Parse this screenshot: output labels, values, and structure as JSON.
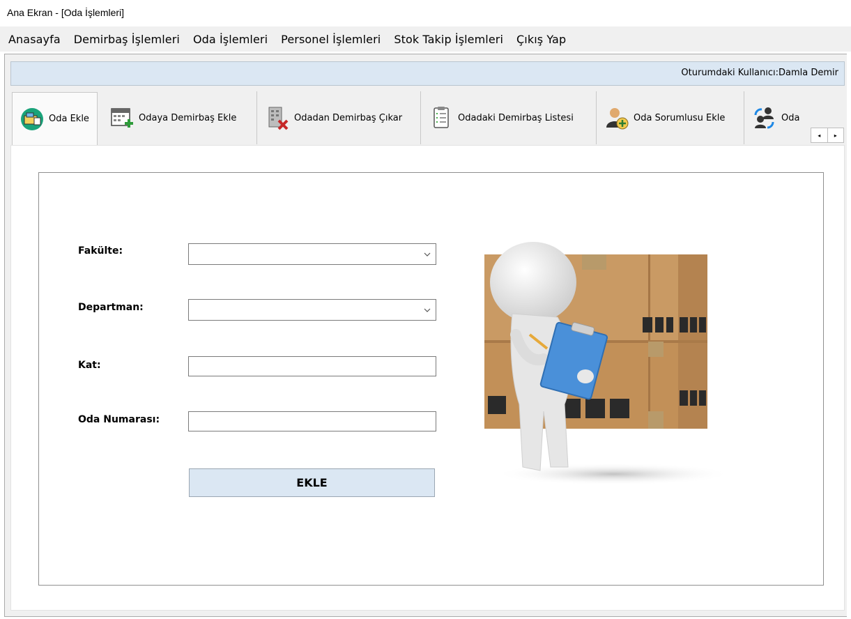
{
  "window": {
    "title": "Ana Ekran - [Oda İşlemleri]"
  },
  "menu": {
    "items": [
      "Anasayfa",
      "Demirbaş İşlemleri",
      "Oda İşlemleri",
      "Personel İşlemleri",
      "Stok Takip İşlemleri",
      "Çıkış Yap"
    ]
  },
  "session": {
    "user_text": "Oturumdaki Kullanıcı:Damla Demir"
  },
  "tabs": [
    {
      "label": "Oda Ekle",
      "icon": "room-add-icon"
    },
    {
      "label": "Odaya Demirbaş Ekle",
      "icon": "calendar-add-icon"
    },
    {
      "label": "Odadan Demirbaş Çıkar",
      "icon": "building-remove-icon"
    },
    {
      "label": "Odadaki Demirbaş Listesi",
      "icon": "clipboard-list-icon"
    },
    {
      "label": "Oda Sorumlusu Ekle",
      "icon": "user-add-icon"
    },
    {
      "label": "Oda",
      "icon": "user-transfer-icon"
    }
  ],
  "tab_scroll": {
    "left": "◂",
    "right": "▸"
  },
  "form": {
    "faculty_label": "Fakülte:",
    "faculty_value": "",
    "department_label": "Departman:",
    "department_value": "",
    "floor_label": "Kat:",
    "floor_value": "",
    "room_number_label": "Oda Numarası:",
    "room_number_value": "",
    "submit_label": "EKLE"
  },
  "colors": {
    "accent_bar": "#dbe7f3",
    "box": "#c9985f",
    "clipboard": "#4a90d9"
  }
}
